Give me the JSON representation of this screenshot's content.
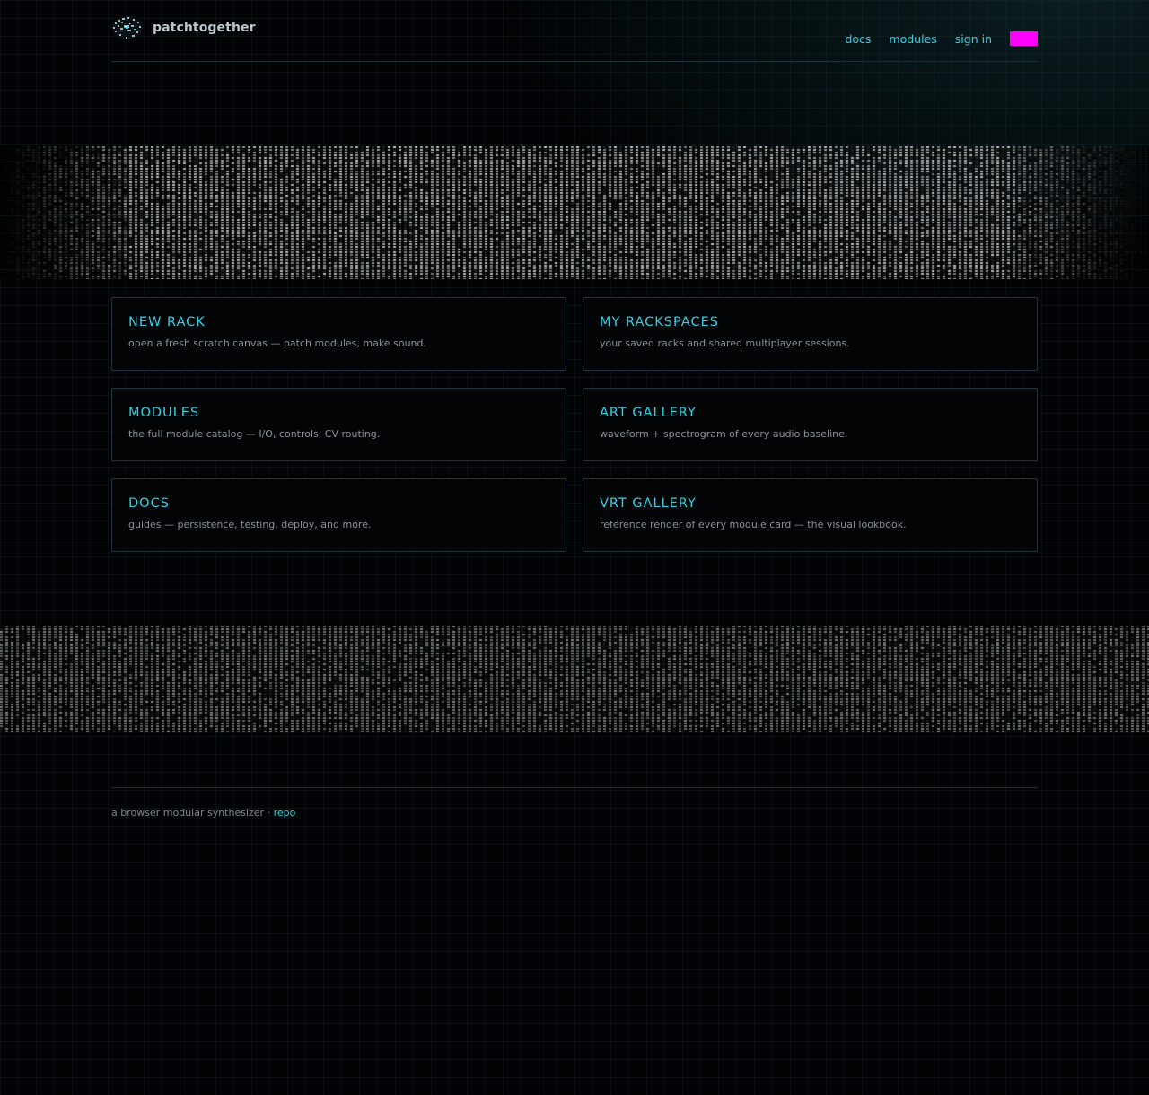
{
  "header": {
    "brand_name": "patchtogether",
    "nav": {
      "docs": "docs",
      "modules": "modules",
      "sign_in": "sign in"
    },
    "accent_color": "#ff00ff"
  },
  "cards": [
    {
      "title": "NEW RACK",
      "description": "open a fresh scratch canvas — patch modules, make sound."
    },
    {
      "title": "MY RACKSPACES",
      "description": "your saved racks and shared multiplayer sessions."
    },
    {
      "title": "MODULES",
      "description": "the full module catalog — I/O, controls, CV routing."
    },
    {
      "title": "ART GALLERY",
      "description": "waveform + spectrogram of every audio baseline."
    },
    {
      "title": "DOCS",
      "description": "guides — persistence, testing, deploy, and more."
    },
    {
      "title": "VRT GALLERY",
      "description": "reference render of every module card — the visual lookbook."
    }
  ],
  "footer": {
    "text": "a browser modular synthesizer ·",
    "repo_link": "repo"
  },
  "colors": {
    "accent_cyan": "#2fd3e6",
    "background": "#020304",
    "card_border": "#1c3540"
  }
}
